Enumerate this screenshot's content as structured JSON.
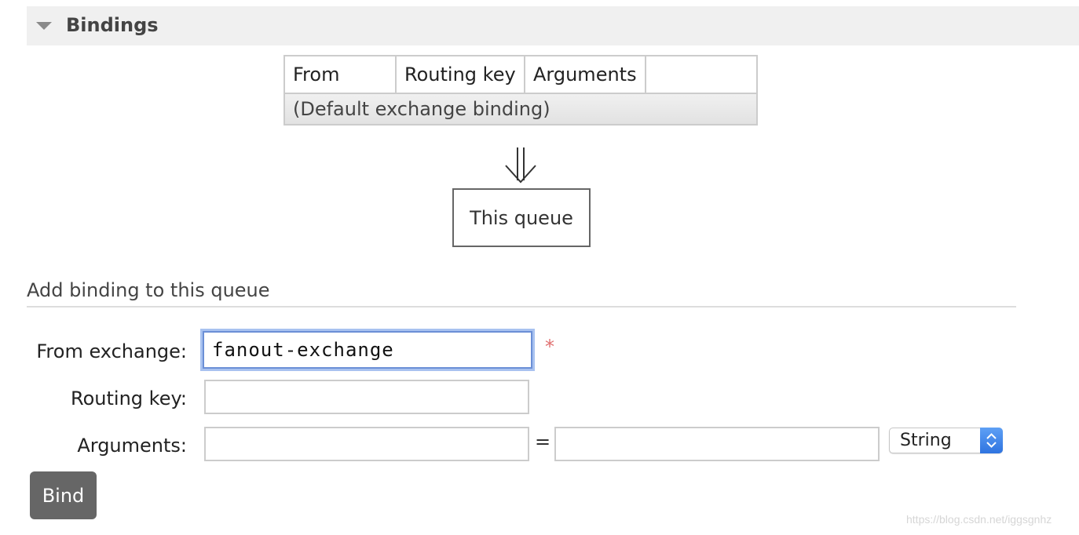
{
  "section": {
    "title": "Bindings"
  },
  "bindings_table": {
    "headers": [
      "From",
      "Routing key",
      "Arguments",
      ""
    ],
    "rows": [
      {
        "from": "(Default exchange binding)"
      }
    ]
  },
  "queue_box": {
    "label": "This queue"
  },
  "add_binding": {
    "heading": "Add binding to this queue",
    "from_exchange": {
      "label": "From exchange:",
      "value": "fanout-exchange",
      "required_mark": "*"
    },
    "routing_key": {
      "label": "Routing key:",
      "value": ""
    },
    "arguments": {
      "label": "Arguments:",
      "key_value": "",
      "equals": "=",
      "value_value": "",
      "type_selected": "String"
    },
    "bind_label": "Bind"
  },
  "watermark": "https://blog.csdn.net/iggsgnhz",
  "colors": {
    "focus_ring": "#a8c2f0",
    "required": "#e07070",
    "button_bg": "#666666"
  }
}
